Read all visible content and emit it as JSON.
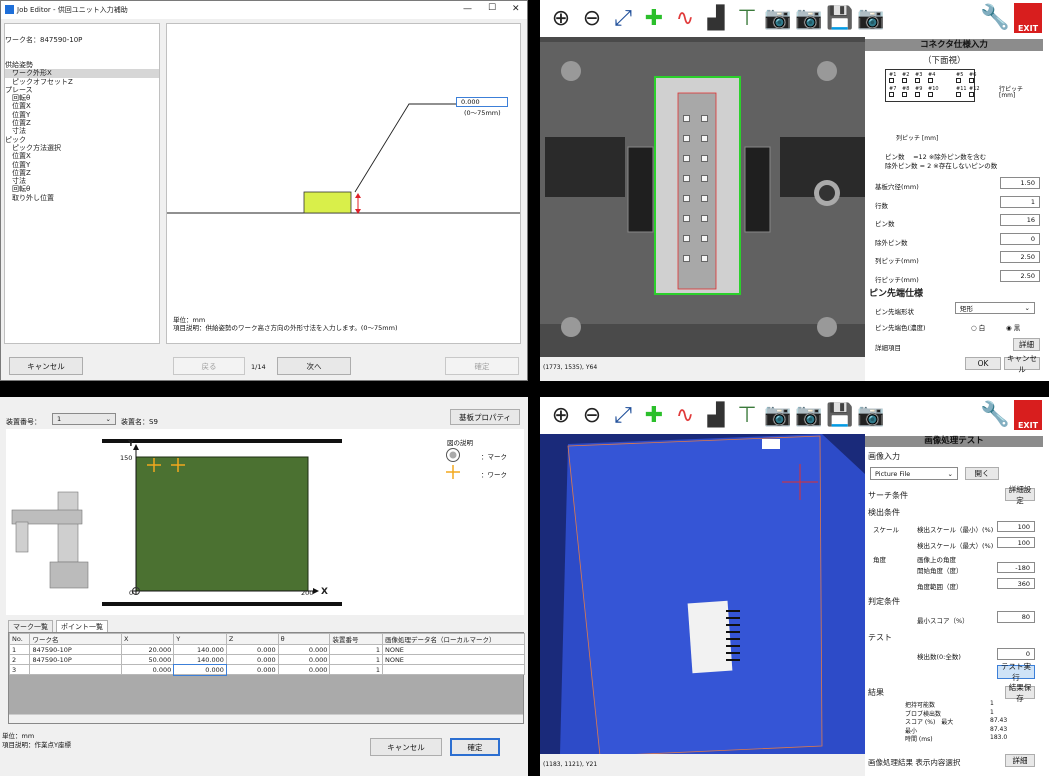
{
  "tl": {
    "title": "Job Editor - 供回ユニット入力補助",
    "win_min": "—",
    "win_max": "☐",
    "win_close": "✕",
    "work_name": "ワーク名：847590-10P",
    "tree": [
      "供給姿勢",
      "　ワーク外形X",
      "　ピックオフセットZ",
      "プレース",
      "　回転θ",
      "　位置X",
      "　位置Y",
      "　位置Z",
      "　寸法",
      "ピック",
      "　ピック方法選択",
      "　位置X",
      "　位置Y",
      "　位置Z",
      "　寸法",
      "　回転θ",
      "　取り外し位置"
    ],
    "value": "0.000",
    "range": "(0〜75mm)",
    "unit": "単位：mm",
    "desc": "項目説明：供給姿勢のワーク高さ方向の外形寸法を入力します。(0〜75mm)",
    "cancel": "キャンセル",
    "back": "戻る",
    "page": "1/14",
    "next": "次へ",
    "confirm": "確定"
  },
  "tr": {
    "panel_title": "コネクタ仕様入力",
    "view": "（下面視）",
    "pins_top": [
      "#1",
      "#2",
      "#3",
      "#4",
      "#5",
      "#6"
    ],
    "pins_bot": [
      "#7",
      "#8",
      "#9",
      "#10",
      "#11",
      "#12"
    ],
    "row_pitch": "行ピッチ",
    "mm": "[mm]",
    "col_pitch": "列ピッチ [mm]",
    "note1": "ピン数　 =12 ※除外ピン数を含む",
    "note2": "除外ピン数 = 2 ※存在しないピンの数",
    "fields": [
      {
        "label": "基板穴径(mm)",
        "value": "1.50"
      },
      {
        "label": "行数",
        "value": "1"
      },
      {
        "label": "ピン数",
        "value": "16"
      },
      {
        "label": "除外ピン数",
        "value": "0"
      },
      {
        "label": "列ピッチ(mm)",
        "value": "2.50"
      },
      {
        "label": "行ピッチ(mm)",
        "value": "2.50"
      }
    ],
    "tip_title": "ピン先端仕様",
    "tip_shape_label": "ピン先端形状",
    "tip_shape_value": "矩形",
    "tip_color_label": "ピン先端色(濃度)",
    "radio_white": "白",
    "radio_black": "黒",
    "detail_label": "詳細項目",
    "detail_btn": "詳細",
    "ok": "OK",
    "cancel": "キャンセル",
    "status": "(1773, 1535), Y64",
    "exit": "EXIT"
  },
  "bl": {
    "device_no_label": "装置番号：",
    "device_no_value": "1",
    "device_name": "装置名：S9",
    "props_btn": "基板プロパティ",
    "legend_title": "図の説明",
    "legend_mark": "：マーク",
    "legend_work": "：ワーク",
    "y_axis": "Y",
    "y_tick": "150",
    "x_axis": "X",
    "x_tick": "200",
    "origin": "0",
    "tabs": [
      "マーク一覧",
      "ポイント一覧"
    ],
    "columns": [
      "No.",
      "ワーク名",
      "X",
      "Y",
      "Z",
      "θ",
      "装置番号",
      "画像処理データ名（ローカルマーク）"
    ],
    "rows": [
      [
        "1",
        "847590-10P",
        "20.000",
        "140.000",
        "0.000",
        "0.000",
        "1",
        "NONE"
      ],
      [
        "2",
        "847590-10P",
        "50.000",
        "140.000",
        "0.000",
        "0.000",
        "1",
        "NONE"
      ],
      [
        "3",
        "",
        "0.000",
        "0.000",
        "0.000",
        "0.000",
        "1",
        ""
      ]
    ],
    "unit": "単位：mm",
    "desc": "項目説明：作業点Y座標",
    "cancel": "キャンセル",
    "confirm": "確定"
  },
  "br": {
    "panel_title": "画像処理テスト",
    "image_input": "画像入力",
    "source": "Picture File",
    "open": "開く",
    "search_cond": "サーチ条件",
    "detail_setting": "詳細設定",
    "detect_cond": "検出条件",
    "scale": "スケール",
    "scale_min_label": "検出スケール（最小）(%)",
    "scale_min": "100",
    "scale_max_label": "検出スケール（最大）(%)",
    "scale_max": "100",
    "angle": "角度",
    "angle_img": "画像上の角度",
    "angle_start_label": "開始角度（度）",
    "angle_start": "-180",
    "angle_range_label": "角度範囲（度）",
    "angle_range": "360",
    "judge": "判定条件",
    "min_score_label": "最小スコア（%）",
    "min_score": "80",
    "test": "テスト",
    "count_label": "検出数(0:全数)",
    "count": "0",
    "run_test": "テスト実行",
    "result": "結果",
    "save_result": "結果保存",
    "res": [
      {
        "label": "把持可能数",
        "value": "1"
      },
      {
        "label": "ブロブ検出数",
        "value": "1"
      },
      {
        "label": "スコア (%)　最大",
        "value": "87.43"
      },
      {
        "label": "最小",
        "value": "87.43"
      },
      {
        "label": "時間 (ms)",
        "value": "183.0"
      }
    ],
    "select_display": "画像処理結果 表示内容選択",
    "detail": "詳細",
    "status": "(1183, 1121), Y21",
    "exit": "EXIT"
  }
}
